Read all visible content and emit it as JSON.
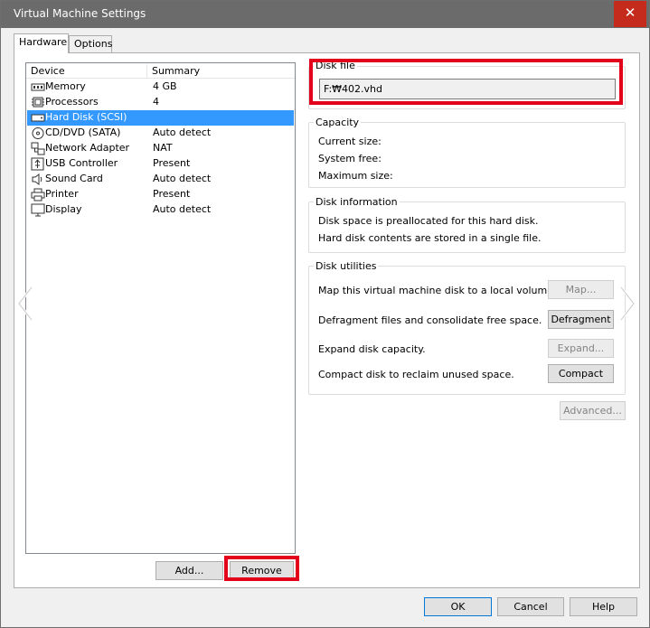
{
  "window": {
    "title": "Virtual Machine Settings",
    "close_symbol": "✕"
  },
  "tabs": [
    {
      "label": "Hardware",
      "active": true
    },
    {
      "label": "Options",
      "active": false
    }
  ],
  "device_list": {
    "columns": [
      "Device",
      "Summary"
    ],
    "rows": [
      {
        "name": "Memory",
        "summary": "4 GB",
        "icon": "memory-icon"
      },
      {
        "name": "Processors",
        "summary": "4",
        "icon": "processor-icon"
      },
      {
        "name": "Hard Disk (SCSI)",
        "summary": "",
        "icon": "hard-disk-icon",
        "selected": true
      },
      {
        "name": "CD/DVD (SATA)",
        "summary": "Auto detect",
        "icon": "cd-dvd-icon"
      },
      {
        "name": "Network Adapter",
        "summary": "NAT",
        "icon": "network-adapter-icon"
      },
      {
        "name": "USB Controller",
        "summary": "Present",
        "icon": "usb-icon"
      },
      {
        "name": "Sound Card",
        "summary": "Auto detect",
        "icon": "speaker-icon"
      },
      {
        "name": "Printer",
        "summary": "Present",
        "icon": "printer-icon"
      },
      {
        "name": "Display",
        "summary": "Auto detect",
        "icon": "display-icon"
      }
    ]
  },
  "list_buttons": {
    "add": "Add...",
    "remove": "Remove"
  },
  "disk_file": {
    "title": "Disk file",
    "value": "F:₩402.vhd"
  },
  "capacity": {
    "title": "Capacity",
    "current_size": "Current size:",
    "system_free": "System free:",
    "maximum_size": "Maximum size:"
  },
  "disk_information": {
    "title": "Disk information",
    "line1": "Disk space is preallocated for this hard disk.",
    "line2": "Hard disk contents are stored in a single file."
  },
  "disk_utilities": {
    "title": "Disk utilities",
    "map_text": "Map this virtual machine disk to a local volume.",
    "map_button": "Map...",
    "defrag_text": "Defragment files and consolidate free space.",
    "defrag_button": "Defragment",
    "expand_text": "Expand disk capacity.",
    "expand_button": "Expand...",
    "compact_text": "Compact disk to reclaim unused space.",
    "compact_button": "Compact"
  },
  "advanced_button": "Advanced...",
  "footer": {
    "ok": "OK",
    "cancel": "Cancel",
    "help": "Help"
  },
  "colors": {
    "highlight": "#e2001a",
    "selection": "#3399ff",
    "titlebar": "#6b6b6b",
    "close": "#c42b1c"
  }
}
